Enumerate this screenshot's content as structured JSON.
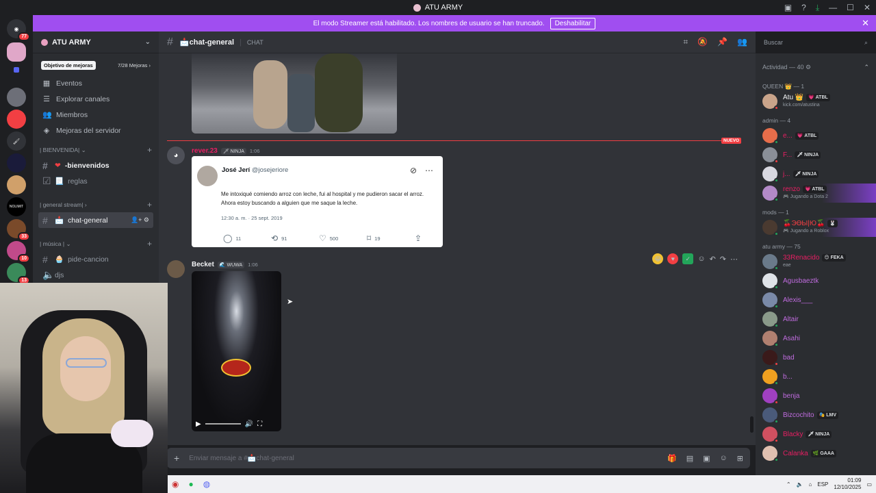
{
  "window": {
    "title": "ATU ARMY"
  },
  "banner": {
    "text": "El modo Streamer está habilitado. Los nombres de usuario se han truncado.",
    "button": "Deshabilitar"
  },
  "guilds": {
    "badges": [
      "77",
      "33",
      "10",
      "13"
    ],
    "label_nolimit": "NOLIMIT"
  },
  "server": {
    "name": "ATU ARMY",
    "boost_goal": "Objetivo de mejoras",
    "boost_count": "7/28 Mejoras",
    "nav": [
      {
        "label": "Eventos",
        "icon": "calendar-icon"
      },
      {
        "label": "Explorar canales",
        "icon": "browse-icon"
      },
      {
        "label": "Miembros",
        "icon": "members-icon"
      },
      {
        "label": "Mejoras del servidor",
        "icon": "boost-icon"
      }
    ],
    "categories": [
      {
        "name": "| BIENVENIDA|",
        "channels": [
          {
            "name": "-bienvenidos",
            "prefix": "❤"
          },
          {
            "name": "reglas",
            "prefix": "📃"
          }
        ]
      },
      {
        "name": "| general stream|",
        "channels": [
          {
            "name": "chat-general",
            "prefix": "📩"
          }
        ]
      },
      {
        "name": "| música |",
        "channels": [
          {
            "name": "pide-cancion",
            "prefix": "🧁"
          },
          {
            "name": "djs",
            "prefix": ""
          }
        ]
      }
    ]
  },
  "chat": {
    "channel": "📩chat-general",
    "topic": "CHAT",
    "search_placeholder": "Buscar",
    "new_label": "NUEVO",
    "composer_placeholder": "Enviar mensaje a #📩chat-general"
  },
  "messages": [
    {
      "author": "rever.23",
      "author_color": "#e91e63",
      "tag": "🗡 NINJA",
      "time": "1:06",
      "embed": {
        "name": "José Jerí",
        "handle": "@josejeriore",
        "text": "Me intoxiqué comiendo arroz con leche, fui al hospital y me pudieron sacar el arroz. Ahora estoy buscando a alguien que me saque la leche.",
        "date": "12:30 a. m. · 25 sept. 2019",
        "replies": "11",
        "retweets": "91",
        "likes": "500",
        "bookmarks": "19"
      }
    },
    {
      "author": "Becket",
      "author_color": "#f2f3f5",
      "tag": "🌊 WUWA",
      "time": "1:06"
    }
  ],
  "members": {
    "activity": "Actividad — 40",
    "groups": [
      {
        "title": "QUEEN 👑 — 1",
        "items": [
          {
            "name": "Atu 👑",
            "tag": "💗 ATBL",
            "sub": "kick.com/atustina",
            "color": "#f2f3f5",
            "status": "dnd"
          }
        ]
      },
      {
        "title": "admin — 4",
        "items": [
          {
            "name": "e...",
            "tag": "💗 ATBL",
            "sub": "",
            "color": "#e91e63",
            "status": "online"
          },
          {
            "name": "F...",
            "tag": "🗡 NINJA",
            "sub": "",
            "color": "#e91e63",
            "status": "dnd"
          },
          {
            "name": "j...",
            "tag": "🗡 NINJA",
            "sub": "",
            "color": "#e91e63",
            "status": "online"
          },
          {
            "name": "renzo",
            "tag": "💗 ATBL",
            "sub": "🎮 Jugando a Dota 2",
            "color": "#e91e63",
            "status": "online",
            "highlight": true
          }
        ]
      },
      {
        "title": "mods — 1",
        "items": [
          {
            "name": "🍒ЭӨЫ|Ю🍒",
            "tag": "🐰",
            "sub": "🎮 Jugando a Roblox",
            "color": "#f23f43",
            "status": "online",
            "highlight": true
          }
        ]
      },
      {
        "title": "atu army — 75",
        "items": [
          {
            "name": "33Renacido",
            "tag": "😊 FEKA",
            "sub": "eae",
            "color": "#e91e63",
            "status": "online"
          },
          {
            "name": "Agusbaeztk",
            "tag": "",
            "sub": "",
            "color": "#c06cdf",
            "status": "online"
          },
          {
            "name": "Alexis___",
            "tag": "",
            "sub": "",
            "color": "#c06cdf",
            "status": "online"
          },
          {
            "name": "Altair",
            "tag": "",
            "sub": "",
            "color": "#c06cdf",
            "status": "online"
          },
          {
            "name": "Asahi",
            "tag": "",
            "sub": "",
            "color": "#c06cdf",
            "status": "online"
          },
          {
            "name": "bad",
            "tag": "",
            "sub": "",
            "color": "#c06cdf",
            "status": "dnd"
          },
          {
            "name": "b...",
            "tag": "",
            "sub": "",
            "color": "#c06cdf",
            "status": "online"
          },
          {
            "name": "benja",
            "tag": "",
            "sub": "",
            "color": "#c06cdf",
            "status": "dnd"
          },
          {
            "name": "Bizcochito",
            "tag": "🎭 LMV",
            "sub": "",
            "color": "#c06cdf",
            "status": "online"
          },
          {
            "name": "Blacky",
            "tag": "🗡 NINJA",
            "sub": "",
            "color": "#e91e63",
            "status": "dnd"
          },
          {
            "name": "Calanka",
            "tag": "🌿 GAAA",
            "sub": "",
            "color": "#e91e63",
            "status": "online"
          }
        ]
      }
    ]
  },
  "taskbar": {
    "lang": "ESP",
    "time": "01:09",
    "date": "12/10/2025"
  },
  "colors": {
    "accent": "#a04ef0",
    "danger": "#f23f43",
    "online": "#23a55a"
  }
}
